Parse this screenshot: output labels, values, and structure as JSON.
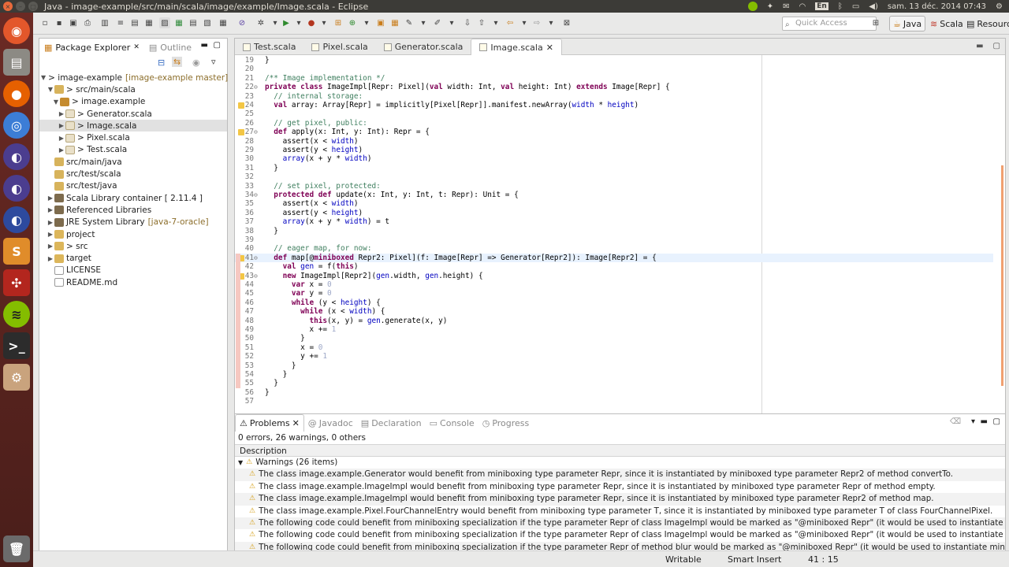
{
  "window": {
    "title": "Java - image-example/src/main/scala/image/example/Image.scala - Eclipse"
  },
  "system": {
    "keyboard": "En",
    "datetime": "sam. 13 déc. 2014 07:43"
  },
  "launcher": {
    "items": [
      "ubuntu-dash",
      "files",
      "firefox",
      "chromium",
      "eclipse-a",
      "eclipse-b",
      "eclipse-c",
      "sublime-text",
      "ubuntu-one",
      "spotify",
      "terminal",
      "system-settings",
      "trash"
    ]
  },
  "toolbar": {
    "quick_access_placeholder": "Quick Access",
    "perspectives": [
      {
        "label": "Java",
        "active": true
      },
      {
        "label": "Scala",
        "active": false
      },
      {
        "label": "Resource",
        "active": false
      }
    ]
  },
  "package_explorer": {
    "tabs": [
      {
        "label": "Package Explorer",
        "active": true
      },
      {
        "label": "Outline",
        "active": false
      }
    ],
    "tree": [
      {
        "depth": 0,
        "twisty": "▼",
        "icon": "proj",
        "label": "> image-example",
        "deco": "[image-example master]"
      },
      {
        "depth": 1,
        "twisty": "▼",
        "icon": "src",
        "label": "> src/main/scala",
        "deco": ""
      },
      {
        "depth": 2,
        "twisty": "▼",
        "icon": "pkgic",
        "label": "> image.example",
        "deco": ""
      },
      {
        "depth": 3,
        "twisty": "▶",
        "icon": "file",
        "label": "> Generator.scala",
        "deco": ""
      },
      {
        "depth": 3,
        "twisty": "▶",
        "icon": "file",
        "label": "> Image.scala",
        "deco": "",
        "selected": true
      },
      {
        "depth": 3,
        "twisty": "▶",
        "icon": "file",
        "label": "> Pixel.scala",
        "deco": ""
      },
      {
        "depth": 3,
        "twisty": "▶",
        "icon": "file",
        "label": "> Test.scala",
        "deco": ""
      },
      {
        "depth": 1,
        "twisty": "",
        "icon": "src",
        "label": "src/main/java",
        "deco": ""
      },
      {
        "depth": 1,
        "twisty": "",
        "icon": "src",
        "label": "src/test/scala",
        "deco": ""
      },
      {
        "depth": 1,
        "twisty": "",
        "icon": "src",
        "label": "src/test/java",
        "deco": ""
      },
      {
        "depth": 1,
        "twisty": "▶",
        "icon": "lib",
        "label": "Scala Library container [ 2.11.4 ]",
        "deco": ""
      },
      {
        "depth": 1,
        "twisty": "▶",
        "icon": "lib",
        "label": "Referenced Libraries",
        "deco": ""
      },
      {
        "depth": 1,
        "twisty": "▶",
        "icon": "lib",
        "label": "JRE System Library",
        "deco": "[java-7-oracle]"
      },
      {
        "depth": 1,
        "twisty": "▶",
        "icon": "fold",
        "label": "project",
        "deco": ""
      },
      {
        "depth": 1,
        "twisty": "▶",
        "icon": "fold",
        "label": "> src",
        "deco": ""
      },
      {
        "depth": 1,
        "twisty": "▶",
        "icon": "fold",
        "label": "target",
        "deco": ""
      },
      {
        "depth": 1,
        "twisty": "",
        "icon": "txt",
        "label": "LICENSE",
        "deco": ""
      },
      {
        "depth": 1,
        "twisty": "",
        "icon": "txt",
        "label": "README.md",
        "deco": ""
      }
    ]
  },
  "editor": {
    "tabs": [
      {
        "label": "Test.scala",
        "active": false
      },
      {
        "label": "Pixel.scala",
        "active": false
      },
      {
        "label": "Generator.scala",
        "active": false
      },
      {
        "label": "Image.scala",
        "active": true
      }
    ],
    "lines": [
      {
        "n": "19",
        "fold": "",
        "code": [
          [
            "p",
            "}"
          ]
        ]
      },
      {
        "n": "20",
        "fold": "",
        "code": []
      },
      {
        "n": "21",
        "fold": "",
        "code": [
          [
            "c",
            "/** Image implementation */"
          ]
        ]
      },
      {
        "n": "22",
        "fold": "⊖",
        "code": [
          [
            "k",
            "private class"
          ],
          [
            "p",
            " ImageImpl[Repr: Pixel]("
          ],
          [
            "k",
            "val"
          ],
          [
            "p",
            " width: Int, "
          ],
          [
            "k",
            "val"
          ],
          [
            "p",
            " height: Int) "
          ],
          [
            "k",
            "extends"
          ],
          [
            "p",
            " Image[Repr] {"
          ]
        ]
      },
      {
        "n": "23",
        "fold": "",
        "code": [
          [
            "c",
            "  // internal storage:"
          ]
        ]
      },
      {
        "n": "24",
        "fold": "",
        "warn": true,
        "code": [
          [
            "k",
            "  val"
          ],
          [
            "p",
            " array: Array[Repr] = implicitly[Pixel[Repr]].manifest.newArray("
          ],
          [
            "f",
            "width"
          ],
          [
            "p",
            " * "
          ],
          [
            "f",
            "height"
          ],
          [
            "p",
            ")"
          ]
        ]
      },
      {
        "n": "25",
        "fold": "",
        "code": []
      },
      {
        "n": "26",
        "fold": "",
        "code": [
          [
            "c",
            "  // get pixel, public:"
          ]
        ]
      },
      {
        "n": "27",
        "fold": "⊖",
        "warn": true,
        "code": [
          [
            "k",
            "  def"
          ],
          [
            "p",
            " apply(x: Int, y: Int): Repr = {"
          ]
        ]
      },
      {
        "n": "28",
        "fold": "",
        "code": [
          [
            "p",
            "    assert(x < "
          ],
          [
            "f",
            "width"
          ],
          [
            "p",
            ")"
          ]
        ]
      },
      {
        "n": "29",
        "fold": "",
        "code": [
          [
            "p",
            "    assert(y < "
          ],
          [
            "f",
            "height"
          ],
          [
            "p",
            ")"
          ]
        ]
      },
      {
        "n": "30",
        "fold": "",
        "code": [
          [
            "p",
            "    "
          ],
          [
            "f",
            "array"
          ],
          [
            "p",
            "(x + y * "
          ],
          [
            "f",
            "width"
          ],
          [
            "p",
            ")"
          ]
        ]
      },
      {
        "n": "31",
        "fold": "",
        "code": [
          [
            "p",
            "  }"
          ]
        ]
      },
      {
        "n": "32",
        "fold": "",
        "code": []
      },
      {
        "n": "33",
        "fold": "",
        "code": [
          [
            "c",
            "  // set pixel, protected:"
          ]
        ]
      },
      {
        "n": "34",
        "fold": "⊖",
        "code": [
          [
            "k",
            "  protected def"
          ],
          [
            "p",
            " update(x: Int, y: Int, t: Repr): Unit = {"
          ]
        ]
      },
      {
        "n": "35",
        "fold": "",
        "code": [
          [
            "p",
            "    assert(x < "
          ],
          [
            "f",
            "width"
          ],
          [
            "p",
            ")"
          ]
        ]
      },
      {
        "n": "36",
        "fold": "",
        "code": [
          [
            "p",
            "    assert(y < "
          ],
          [
            "f",
            "height"
          ],
          [
            "p",
            ")"
          ]
        ]
      },
      {
        "n": "37",
        "fold": "",
        "code": [
          [
            "p",
            "    "
          ],
          [
            "f",
            "array"
          ],
          [
            "p",
            "(x + y * "
          ],
          [
            "f",
            "width"
          ],
          [
            "p",
            ") = t"
          ]
        ]
      },
      {
        "n": "38",
        "fold": "",
        "code": [
          [
            "p",
            "  }"
          ]
        ]
      },
      {
        "n": "39",
        "fold": "",
        "code": []
      },
      {
        "n": "40",
        "fold": "",
        "code": [
          [
            "c",
            "  // eager map, for now:"
          ]
        ]
      },
      {
        "n": "41",
        "fold": "⊖",
        "warn": true,
        "cur": true,
        "code": [
          [
            "k",
            "  def"
          ],
          [
            "p",
            " map[@"
          ],
          [
            "k",
            "miniboxed"
          ],
          [
            "p",
            " Repr2: Pixel](f: Image[Repr] => Generator[Repr2]): Image[Repr2] = {"
          ]
        ]
      },
      {
        "n": "42",
        "fold": "",
        "code": [
          [
            "k",
            "    val"
          ],
          [
            "p",
            " "
          ],
          [
            "f",
            "gen"
          ],
          [
            "p",
            " = f("
          ],
          [
            "k",
            "this"
          ],
          [
            "p",
            ")"
          ]
        ]
      },
      {
        "n": "43",
        "fold": "⊖",
        "warn": true,
        "code": [
          [
            "k",
            "    new"
          ],
          [
            "p",
            " ImageImpl[Repr2]("
          ],
          [
            "f",
            "gen"
          ],
          [
            "p",
            ".width, "
          ],
          [
            "f",
            "gen"
          ],
          [
            "p",
            ".height) {"
          ]
        ]
      },
      {
        "n": "44",
        "fold": "",
        "code": [
          [
            "k",
            "      var"
          ],
          [
            "p",
            " x = "
          ],
          [
            "n",
            "0"
          ]
        ]
      },
      {
        "n": "45",
        "fold": "",
        "code": [
          [
            "k",
            "      var"
          ],
          [
            "p",
            " y = "
          ],
          [
            "n",
            "0"
          ]
        ]
      },
      {
        "n": "46",
        "fold": "",
        "code": [
          [
            "k",
            "      while"
          ],
          [
            "p",
            " (y < "
          ],
          [
            "f",
            "height"
          ],
          [
            "p",
            ") {"
          ]
        ]
      },
      {
        "n": "47",
        "fold": "",
        "code": [
          [
            "k",
            "        while"
          ],
          [
            "p",
            " (x < "
          ],
          [
            "f",
            "width"
          ],
          [
            "p",
            ") {"
          ]
        ]
      },
      {
        "n": "48",
        "fold": "",
        "code": [
          [
            "k",
            "          this"
          ],
          [
            "p",
            "(x, y) = "
          ],
          [
            "f",
            "gen"
          ],
          [
            "p",
            ".generate(x, y)"
          ]
        ]
      },
      {
        "n": "49",
        "fold": "",
        "code": [
          [
            "p",
            "          x += "
          ],
          [
            "n",
            "1"
          ]
        ]
      },
      {
        "n": "50",
        "fold": "",
        "code": [
          [
            "p",
            "        }"
          ]
        ]
      },
      {
        "n": "51",
        "fold": "",
        "code": [
          [
            "p",
            "        x = "
          ],
          [
            "n",
            "0"
          ]
        ]
      },
      {
        "n": "52",
        "fold": "",
        "code": [
          [
            "p",
            "        y += "
          ],
          [
            "n",
            "1"
          ]
        ]
      },
      {
        "n": "53",
        "fold": "",
        "code": [
          [
            "p",
            "      }"
          ]
        ]
      },
      {
        "n": "54",
        "fold": "",
        "code": [
          [
            "p",
            "    }"
          ]
        ]
      },
      {
        "n": "55",
        "fold": "",
        "code": [
          [
            "p",
            "  }"
          ]
        ]
      },
      {
        "n": "56",
        "fold": "",
        "code": [
          [
            "p",
            "}"
          ]
        ]
      },
      {
        "n": "57",
        "fold": "",
        "code": []
      }
    ]
  },
  "problems": {
    "tabs": [
      {
        "label": "Problems",
        "active": true
      },
      {
        "label": "Javadoc",
        "active": false
      },
      {
        "label": "Declaration",
        "active": false
      },
      {
        "label": "Console",
        "active": false
      },
      {
        "label": "Progress",
        "active": false
      }
    ],
    "summary": "0 errors, 26 warnings, 0 others",
    "column_header": "Description",
    "group_label": "Warnings (26 items)",
    "rows": [
      "The class image.example.Generator would benefit from miniboxing type parameter Repr, since it is instantiated by miniboxed type parameter Repr2 of method convertTo.",
      "The class image.example.ImageImpl would benefit from miniboxing type parameter Repr, since it is instantiated by miniboxed type parameter Repr of method empty.",
      "The class image.example.ImageImpl would benefit from miniboxing type parameter Repr, since it is instantiated by miniboxed type parameter Repr2 of method map.",
      "The class image.example.Pixel.FourChannelEntry would benefit from miniboxing type parameter T, since it is instantiated by miniboxed type parameter T of class FourChannelPixel.",
      "The following code could benefit from miniboxing specialization if the type parameter Repr of class ImageImpl would be marked as \"@miniboxed Repr\" (it would be used to instantiate miniboxed type parameter R",
      "The following code could benefit from miniboxing specialization if the type parameter Repr of class ImageImpl would be marked as \"@miniboxed Repr\" (it would be used to instantiate miniboxed type parameter R",
      "The following code could benefit from miniboxing specialization if the type parameter Repr of method blur would be marked as \"@miniboxed Repr\" (it would be used to instantiate miniboxed type parameter Repr"
    ]
  },
  "statusbar": {
    "mode": "Writable",
    "insert": "Smart Insert",
    "position": "41 : 15"
  }
}
